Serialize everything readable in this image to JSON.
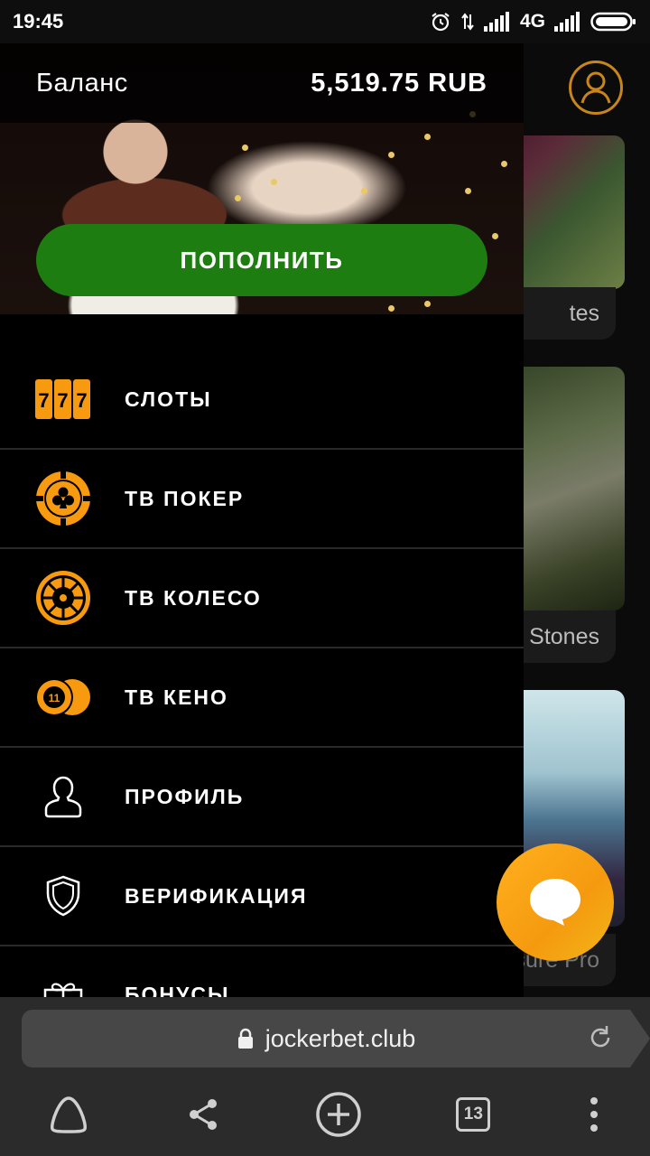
{
  "status_bar": {
    "time": "19:45",
    "network": "4G",
    "icons": [
      "alarm-icon",
      "data-arrows-icon",
      "signal-icon",
      "signal-icon",
      "battery-icon"
    ]
  },
  "drawer": {
    "balance_label": "Баланс",
    "balance_value": "5,519.75 RUB",
    "topup_label": "ПОПОЛНИТЬ",
    "menu": [
      {
        "label": "СЛОТЫ",
        "icon": "slots-777-icon"
      },
      {
        "label": "ТВ ПОКЕР",
        "icon": "poker-chip-club-icon"
      },
      {
        "label": "ТВ КОЛЕСО",
        "icon": "wheel-icon"
      },
      {
        "label": "ТВ КЕНО",
        "icon": "keno-ball-icon",
        "badge": "11"
      },
      {
        "label": "ПРОФИЛЬ",
        "icon": "user-icon"
      },
      {
        "label": "ВЕРИФИКАЦИЯ",
        "icon": "shield-icon"
      },
      {
        "label": "БОНУСЫ",
        "icon": "gift-icon"
      }
    ]
  },
  "background_games": [
    {
      "label": "tes"
    },
    {
      "label": "Stones"
    },
    {
      "label": "sure Pro"
    }
  ],
  "browser": {
    "url": "jockerbet.club",
    "tab_count": "13",
    "nav_icons": [
      "alice-home-icon",
      "share-icon",
      "new-tab-plus-icon",
      "tabs-icon",
      "more-vertical-icon"
    ]
  },
  "colors": {
    "accent_orange": "#f79a0f",
    "topup_green": "#1e7d10",
    "avatar_ring": "#c8861a"
  }
}
